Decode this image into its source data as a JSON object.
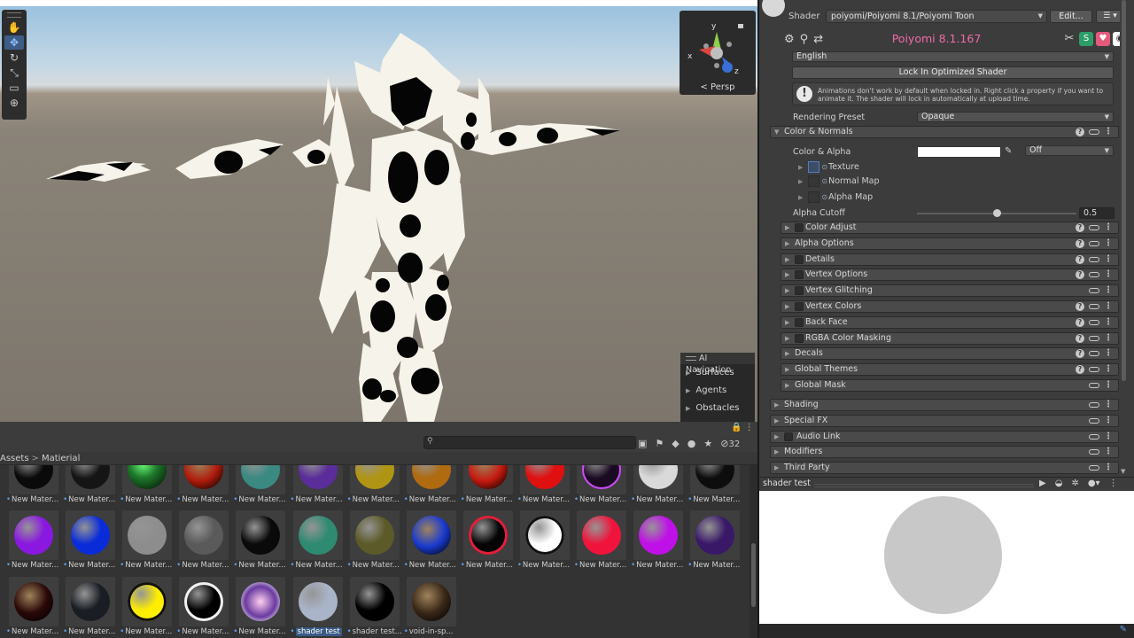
{
  "scene": {
    "tools": [
      "hand-tool",
      "move-tool",
      "rotate-tool",
      "scale-tool",
      "rect-tool",
      "transform-tool"
    ],
    "gizmo": {
      "axis_y": "y",
      "axis_x": "x",
      "axis_z": "z",
      "projection": "Persp"
    },
    "ai_navigation": {
      "title": "AI Navigation",
      "items": [
        "Surfaces",
        "Agents",
        "Obstacles"
      ]
    }
  },
  "project": {
    "search": {
      "placeholder": ""
    },
    "hidden_count": "32",
    "breadcrumb": {
      "root": "Assets",
      "folder": "Matierial"
    },
    "materials_row1": [
      {
        "label": "New Mater...",
        "color": "#0a0a0a",
        "style": "dark"
      },
      {
        "label": "New Mater...",
        "color": "#151515",
        "style": "dark"
      },
      {
        "label": "New Mater...",
        "color": "#1f7a2c",
        "style": "green"
      },
      {
        "label": "New Mater...",
        "color": "#b01c0c",
        "style": "lava"
      },
      {
        "label": "New Mater...",
        "color": "#3a8a82",
        "style": "plain"
      },
      {
        "label": "New Mater...",
        "color": "#5b2d9a",
        "style": "plain"
      },
      {
        "label": "New Mater...",
        "color": "#b09515",
        "style": "plain"
      },
      {
        "label": "New Mater...",
        "color": "#b06a10",
        "style": "plain"
      },
      {
        "label": "New Mater...",
        "color": "#c61a10",
        "style": "lava"
      },
      {
        "label": "New Mater...",
        "color": "#e01010",
        "style": "plain"
      },
      {
        "label": "New Mater...",
        "color": "#1a0a22",
        "style": "ring"
      },
      {
        "label": "New Mater...",
        "color": "#d9d9d9",
        "style": "plain"
      },
      {
        "label": "New Mater...",
        "color": "#0d0d0d",
        "style": "plain"
      }
    ],
    "materials_row2": [
      {
        "label": "New Mater...",
        "color": "#8a18e0",
        "style": "plain"
      },
      {
        "label": "New Mater...",
        "color": "#0a2cd8",
        "style": "plain"
      },
      {
        "label": "New Mater...",
        "color": "#8d8d8d",
        "style": "plain"
      },
      {
        "label": "New Mater...",
        "color": "#5a5a5a",
        "style": "plain"
      },
      {
        "label": "New Mater...",
        "color": "#0a0a0a",
        "style": "plain"
      },
      {
        "label": "New Mater...",
        "color": "#2f8a72",
        "style": "plain"
      },
      {
        "label": "New Mater...",
        "color": "#5c5a28",
        "style": "plain"
      },
      {
        "label": "New Mater...",
        "color": "#1a3ad0",
        "style": "lava"
      },
      {
        "label": "New Mater...",
        "color": "#050505",
        "style": "redring"
      },
      {
        "label": "New Mater...",
        "color": "#ffffff",
        "style": "blackring"
      },
      {
        "label": "New Mater...",
        "color": "#f0143c",
        "style": "plain"
      },
      {
        "label": "New Mater...",
        "color": "#c010e8",
        "style": "plain"
      },
      {
        "label": "New Mater...",
        "color": "#3a1868",
        "style": "plain"
      }
    ],
    "materials_row3": [
      {
        "label": "New Mater...",
        "color": "#2a0808",
        "style": "lava"
      },
      {
        "label": "New Mater...",
        "color": "#1a1e24",
        "style": "plain"
      },
      {
        "label": "New Mater...",
        "color": "#ffee00",
        "style": "blackring"
      },
      {
        "label": "New Mater...",
        "color": "#000000",
        "style": "whitering"
      },
      {
        "label": "New Mater...",
        "color": "#6a3aa0",
        "style": "plasma"
      },
      {
        "label": "shader test",
        "color": "#aab4c8",
        "style": "plain",
        "selected": true
      },
      {
        "label": "shader test...",
        "color": "#000000",
        "style": "plain"
      },
      {
        "label": "void-in-sp...",
        "color": "#3a2818",
        "style": "lava"
      }
    ]
  },
  "inspector": {
    "shader_label": "Shader",
    "shader_value": "poiyomi/Poiyomi 8.1/Poiyomi Toon",
    "edit_label": "Edit...",
    "poiyomi_title": "Poiyomi 8.1.167",
    "language": "English",
    "lock_button": "Lock In Optimized Shader",
    "notice": "Animations don't work by default when locked in. Right click a property if you want to animate it. The shader will lock in automatically at upload time.",
    "rendering_preset_label": "Rendering Preset",
    "rendering_preset_value": "Opaque",
    "color_normals": "Color & Normals",
    "color_alpha_label": "Color & Alpha",
    "color_alpha_mode": "Off",
    "texture_rows": [
      "Texture",
      "Normal Map",
      "Alpha Map"
    ],
    "alpha_cutoff_label": "Alpha Cutoff",
    "alpha_cutoff_value": "0.5",
    "alpha_cutoff_level": 0.5,
    "subsections": [
      {
        "name": "Color Adjust",
        "checkbox": true,
        "help": true
      },
      {
        "name": "Alpha Options",
        "checkbox": false,
        "help": true
      },
      {
        "name": "Details",
        "checkbox": true,
        "help": true
      },
      {
        "name": "Vertex Options",
        "checkbox": true,
        "help": true
      },
      {
        "name": "Vertex Glitching",
        "checkbox": true,
        "help": false
      },
      {
        "name": "Vertex Colors",
        "checkbox": true,
        "help": true
      },
      {
        "name": "Back Face",
        "checkbox": true,
        "help": true
      },
      {
        "name": "RGBA Color Masking",
        "checkbox": true,
        "help": true
      },
      {
        "name": "Decals",
        "checkbox": false,
        "help": true
      },
      {
        "name": "Global Themes",
        "checkbox": false,
        "help": true
      },
      {
        "name": "Global Mask",
        "checkbox": false,
        "help": false
      }
    ],
    "sections": [
      {
        "name": "Shading",
        "checkbox": false
      },
      {
        "name": "Special FX",
        "checkbox": false
      },
      {
        "name": "Audio Link",
        "checkbox": true
      },
      {
        "name": "Modifiers",
        "checkbox": false
      },
      {
        "name": "Third Party",
        "checkbox": false
      }
    ]
  },
  "preview": {
    "title": "shader test",
    "ball_color": "#c8c8c8"
  },
  "colors": {
    "accent_pink": "#f06aa8",
    "selection_blue": "#3a5b85"
  }
}
